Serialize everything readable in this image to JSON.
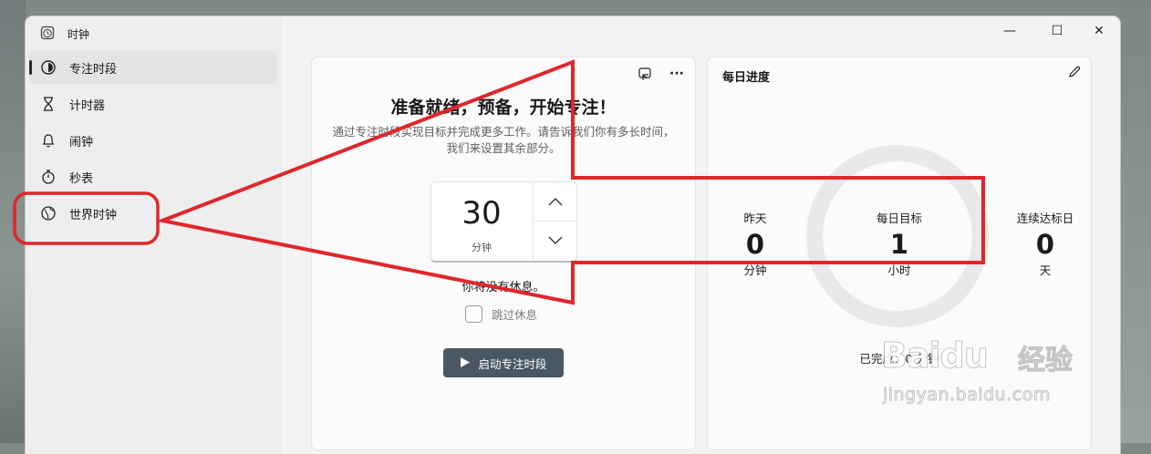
{
  "app": {
    "title": "时钟"
  },
  "window_controls": {
    "minimize": "—",
    "maximize": "☐",
    "close": "✕"
  },
  "sidebar": {
    "items": [
      {
        "label": "专注时段",
        "icon": "focus-icon",
        "active": true
      },
      {
        "label": "计时器",
        "icon": "hourglass-icon",
        "active": false
      },
      {
        "label": "闹钟",
        "icon": "bell-icon",
        "active": false
      },
      {
        "label": "秒表",
        "icon": "stopwatch-icon",
        "active": false
      },
      {
        "label": "世界时钟",
        "icon": "globe-icon",
        "active": false
      }
    ]
  },
  "focus": {
    "title": "准备就绪，预备，开始专注！",
    "description": "通过专注时段实现目标并完成更多工作。请告诉我们你有多长时间，我们来设置其余部分。",
    "duration_value": "30",
    "duration_unit": "分钟",
    "break_text": "你将没有休息。",
    "skip_break_label": "跳过休息",
    "skip_break_checked": false,
    "start_button_label": "启动专注时段"
  },
  "progress": {
    "title": "每日进度",
    "yesterday": {
      "label": "昨天",
      "value": "0",
      "unit": "分钟"
    },
    "daily_goal": {
      "label": "每日目标",
      "value": "1",
      "unit": "小时"
    },
    "streak": {
      "label": "连续达标日",
      "value": "0",
      "unit": "天"
    },
    "completed_text": "已完成：0 分钟"
  },
  "watermark": {
    "brand": "Baidu",
    "brand_cn": "经验",
    "url": "jingyan.baidu.com"
  },
  "colors": {
    "annotation": "#e0262b",
    "start_button": "#4b5863",
    "ring": "#e9e9e9"
  }
}
